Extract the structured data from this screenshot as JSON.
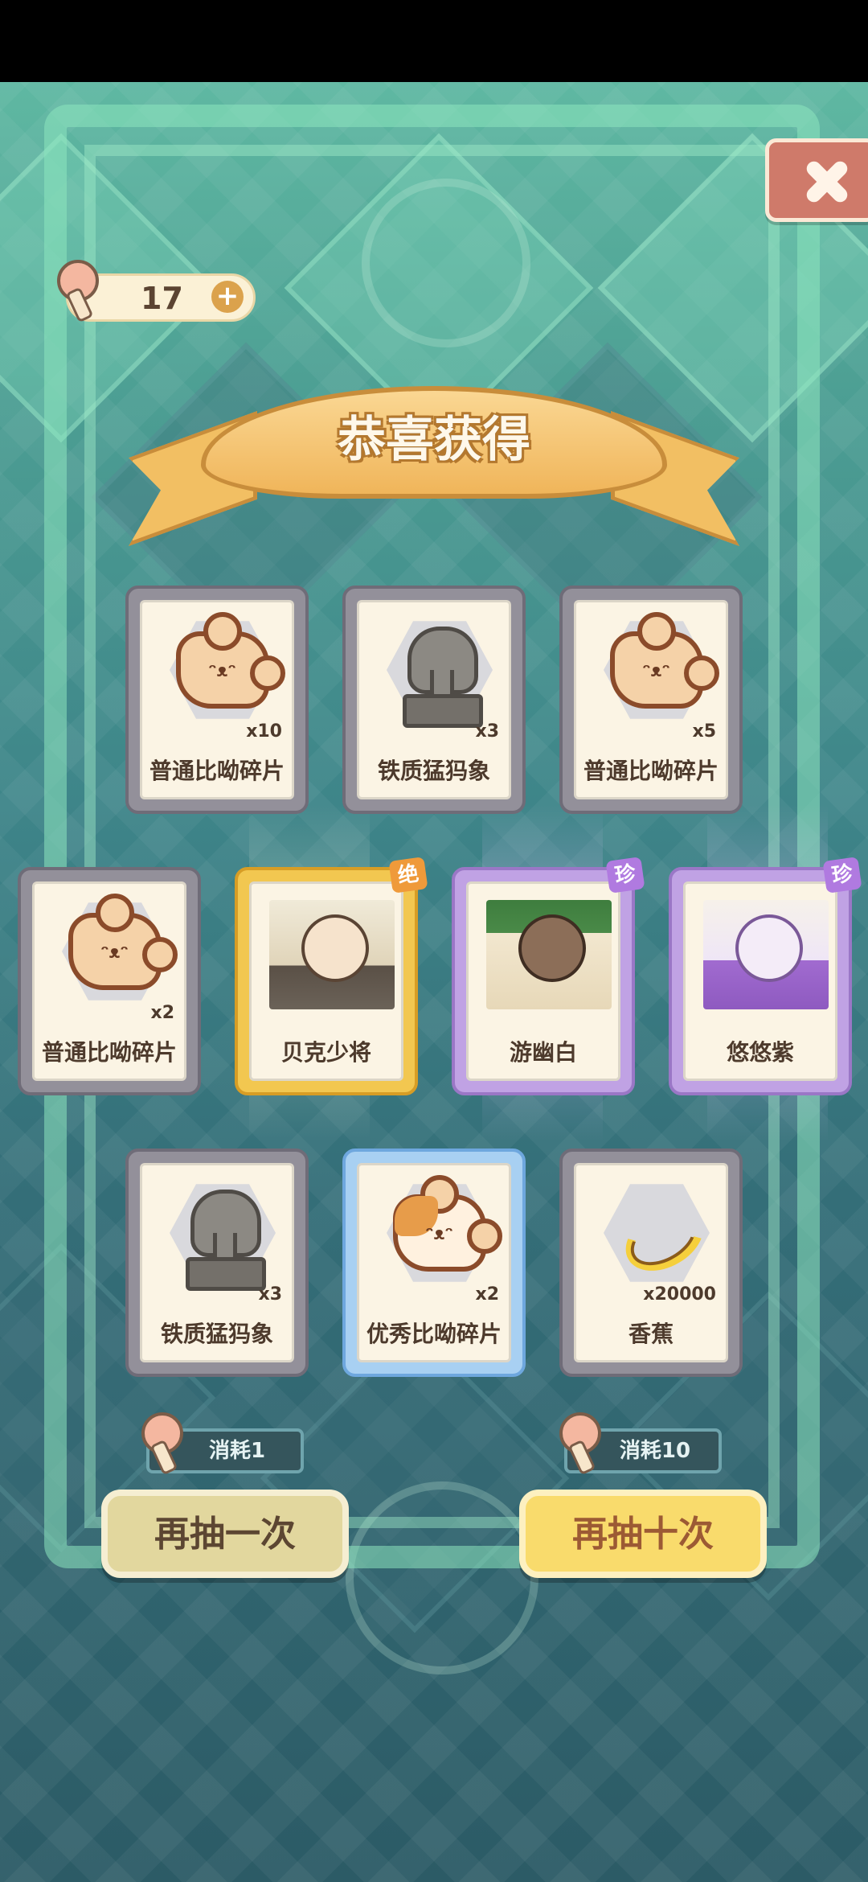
{
  "currency": {
    "count": "17",
    "plus": "+"
  },
  "banner": {
    "title": "恭喜获得"
  },
  "rewards": [
    {
      "name": "普通比呦碎片",
      "qty": "x10",
      "rarity": "normal",
      "art": "common-puzzle-piece-icon",
      "badge": ""
    },
    {
      "name": "铁质猛犸象",
      "qty": "x3",
      "rarity": "normal",
      "art": "iron-mammoth-icon",
      "badge": ""
    },
    {
      "name": "普通比呦碎片",
      "qty": "x5",
      "rarity": "normal",
      "art": "common-puzzle-piece-icon",
      "badge": ""
    },
    {
      "name": "普通比呦碎片",
      "qty": "x2",
      "rarity": "normal",
      "art": "common-puzzle-piece-icon",
      "badge": ""
    },
    {
      "name": "贝克少将",
      "qty": "",
      "rarity": "gold",
      "art": "character-portrait",
      "badge": "绝"
    },
    {
      "name": "游幽白",
      "qty": "",
      "rarity": "purple",
      "art": "character-portrait",
      "badge": "珍"
    },
    {
      "name": "悠悠紫",
      "qty": "",
      "rarity": "purple",
      "art": "character-portrait",
      "badge": "珍"
    },
    {
      "name": "铁质猛犸象",
      "qty": "x3",
      "rarity": "normal",
      "art": "iron-mammoth-icon",
      "badge": ""
    },
    {
      "name": "优秀比呦碎片",
      "qty": "x2",
      "rarity": "blue",
      "art": "excellent-puzzle-piece-icon",
      "badge": ""
    },
    {
      "name": "香蕉",
      "qty": "x20000",
      "rarity": "normal",
      "art": "banana-icon",
      "badge": ""
    }
  ],
  "actions": {
    "once": {
      "cost": "消耗1",
      "label": "再抽一次"
    },
    "ten": {
      "cost": "消耗10",
      "label": "再抽十次"
    }
  },
  "colors": {
    "normal_frame": "#93909a",
    "gold_frame": "#f2c750",
    "purple_frame": "#c0a2e4",
    "blue_frame": "#a8d0f2",
    "button_once": "#e2d79e",
    "button_ten": "#f9db6c"
  }
}
